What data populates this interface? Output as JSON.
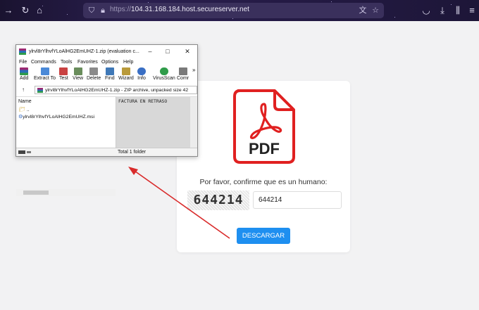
{
  "browser": {
    "url_prefix": "https://",
    "url_host": "104.31.168.184.host.secureserver.net"
  },
  "winrar": {
    "title": "ylrvl8rYlhvfYLoAlHG2EmUHZ-1.zip (evaluation c...",
    "menu": [
      "File",
      "Commands",
      "Tools",
      "Favorites",
      "Options",
      "Help"
    ],
    "tools": [
      "Add",
      "Extract To",
      "Test",
      "View",
      "Delete",
      "Find",
      "Wizard",
      "Info",
      "VirusScan",
      "Comr"
    ],
    "address": "ylrvl8rYlhvfYLoAlHG2EmUHZ-1.zip - ZIP archive, unpacked size 42",
    "column_name": "Name",
    "rows": [
      "..",
      "ylrvl8rYlhvfYLoAlHG2EmUHZ.msi"
    ],
    "comment": "FACTURA EN RETRASO",
    "status": "Total 1 folder"
  },
  "card": {
    "pdf_label": "PDF",
    "captcha_prompt": "Por favor, confirme que es un humano:",
    "captcha_code": "644214",
    "captcha_value": "644214",
    "download_label": "DESCARGAR"
  },
  "colors": {
    "pdf_red": "#e02020",
    "button_blue": "#1e8ff0",
    "arrow_red": "#d92b2b"
  }
}
